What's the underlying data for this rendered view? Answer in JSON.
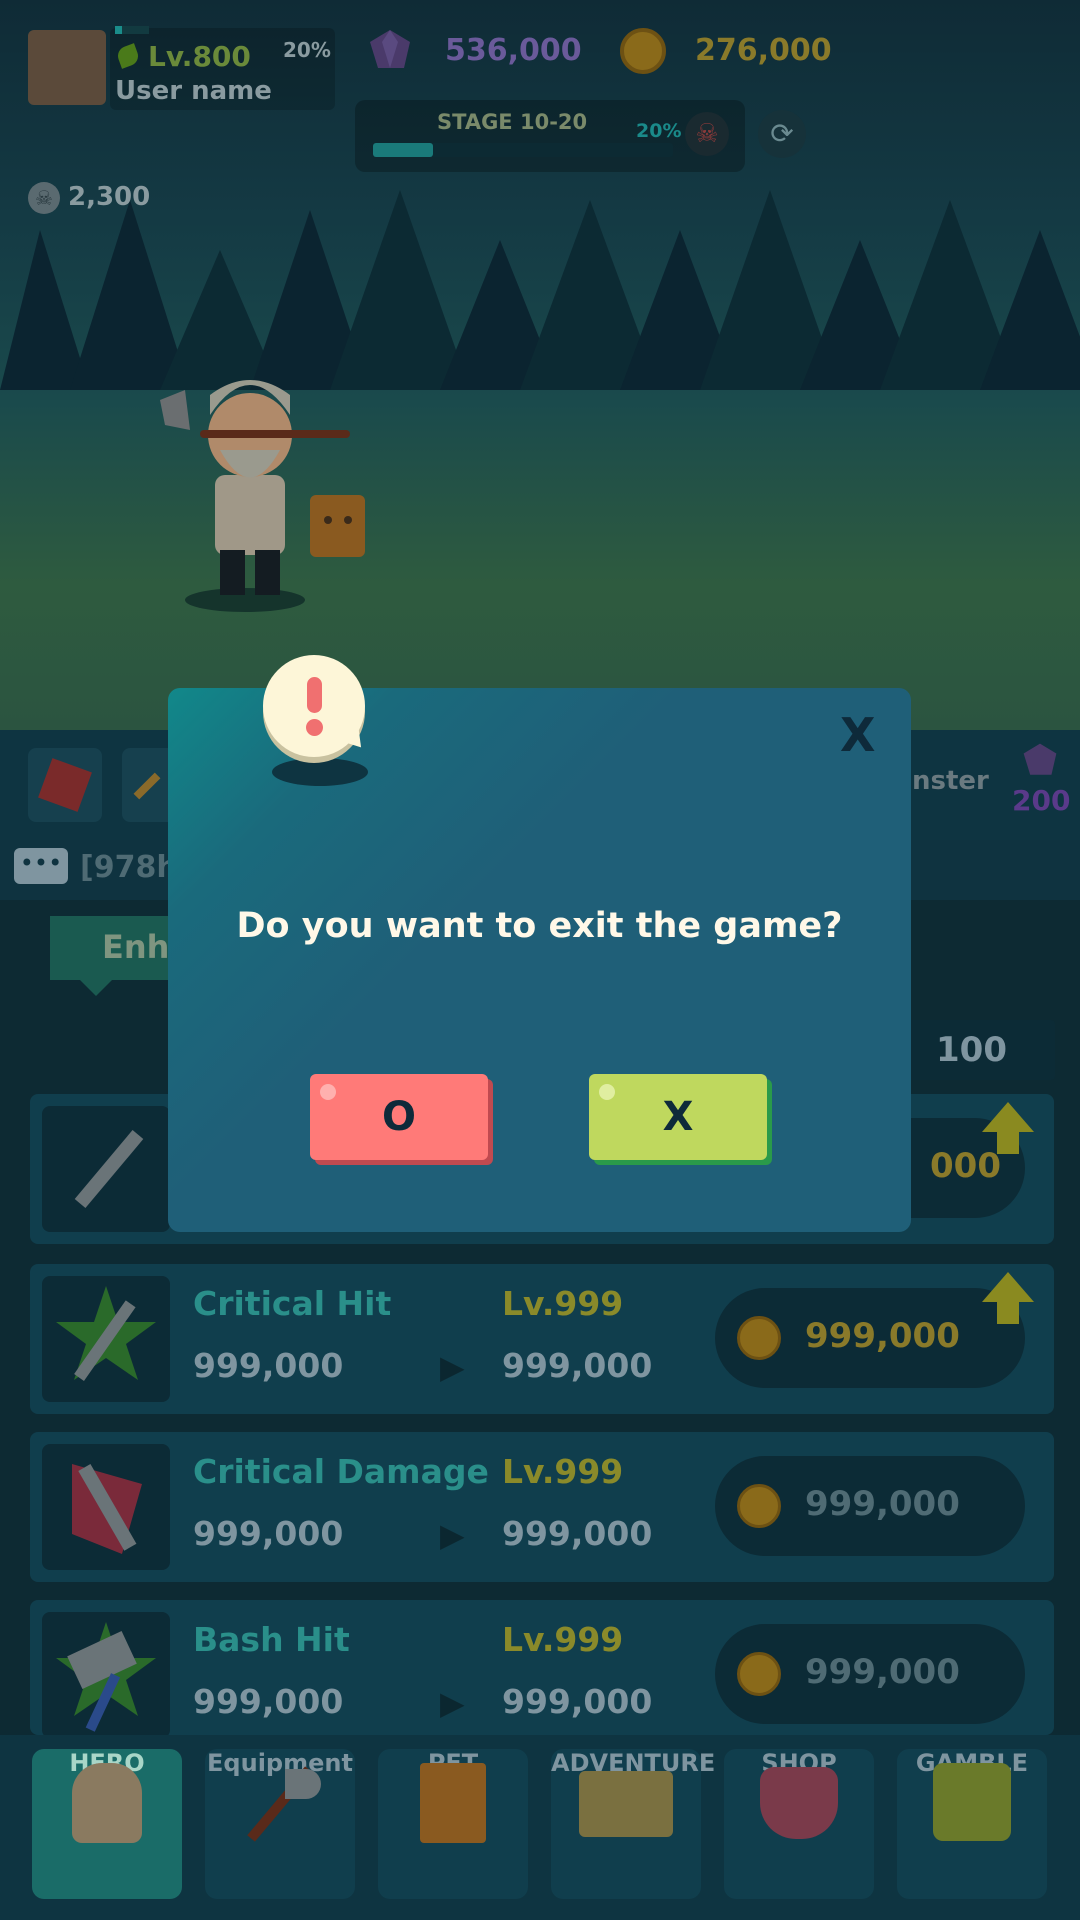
{
  "hud": {
    "level": "Lv.800",
    "level_percent": "20%",
    "level_progress": 0.2,
    "username": "User name",
    "gems": "536,000",
    "coins": "276,000",
    "stage": "STAGE 10-20",
    "stage_percent": "20%",
    "stage_progress": 0.2,
    "skulls": "2,300"
  },
  "partial": {
    "monster_text": "nster",
    "monster_gems": "200",
    "chat_text": "[978h",
    "tab_text": "Enha",
    "count_text": "100",
    "first_cost": "000"
  },
  "rows": [
    {
      "title": "Critical Hit",
      "level": "Lv.999",
      "current": "999,000",
      "next": "999,000",
      "cost": "999,000"
    },
    {
      "title": "Critical Damage",
      "level": "Lv.999",
      "current": "999,000",
      "next": "999,000",
      "cost": "999,000"
    },
    {
      "title": "Bash Hit",
      "level": "Lv.999",
      "current": "999,000",
      "next": "999,000",
      "cost": "999,000"
    }
  ],
  "nav": [
    "HERO",
    "Equipment",
    "PET",
    "ADVENTURE",
    "SHOP",
    "GAMBLE"
  ],
  "dialog": {
    "message": "Do you want to exit the game?",
    "confirm_label": "O",
    "cancel_label": "X",
    "close_label": "X"
  },
  "colors": {
    "confirm": "#ff7a78",
    "cancel": "#bfd85e",
    "alert_icon": "#f07070"
  },
  "icons": [
    "exclamation-icon",
    "gem-icon",
    "coin-icon",
    "skull-icon",
    "refresh-icon",
    "chat-icon",
    "sword-icon",
    "axe-icon",
    "shield-icon",
    "up-arrow-icon"
  ]
}
